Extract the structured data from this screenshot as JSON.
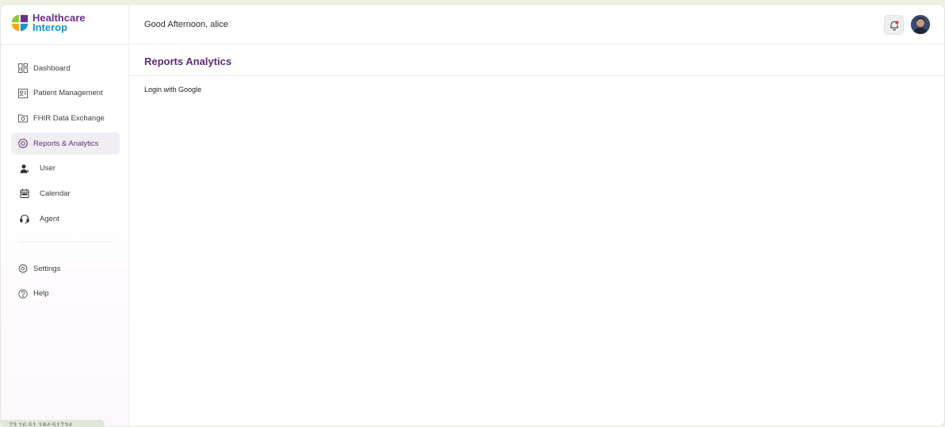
{
  "brand": {
    "line1": "Healthcare",
    "line2": "Interop",
    "colors": {
      "purple": "#6b2f8a",
      "blue": "#1597c9",
      "green": "#8cc63f",
      "orange": "#f5a623"
    }
  },
  "nav": {
    "items": [
      {
        "label": "Dashboard",
        "icon": "dashboard-icon"
      },
      {
        "label": "Patient Management",
        "icon": "patient-card-icon"
      },
      {
        "label": "FHIR Data Exchange",
        "icon": "folder-exchange-icon"
      },
      {
        "label": "Reports & Analytics",
        "icon": "analytics-circle-icon",
        "active": true
      },
      {
        "label": "User",
        "icon": "user-icon"
      },
      {
        "label": "Calendar",
        "icon": "calendar-icon"
      },
      {
        "label": "Agent",
        "icon": "headset-icon"
      }
    ],
    "secondary": [
      {
        "label": "Settings",
        "icon": "gear-icon"
      },
      {
        "label": "Help",
        "icon": "help-circle-icon"
      }
    ]
  },
  "footer": {
    "ip": "73.16.51.184:51734"
  },
  "header": {
    "greeting": "Good Afternoon, alice",
    "notification_icon": "bell-icon"
  },
  "page": {
    "title": "Reports Analytics",
    "link": "Login with Google"
  }
}
